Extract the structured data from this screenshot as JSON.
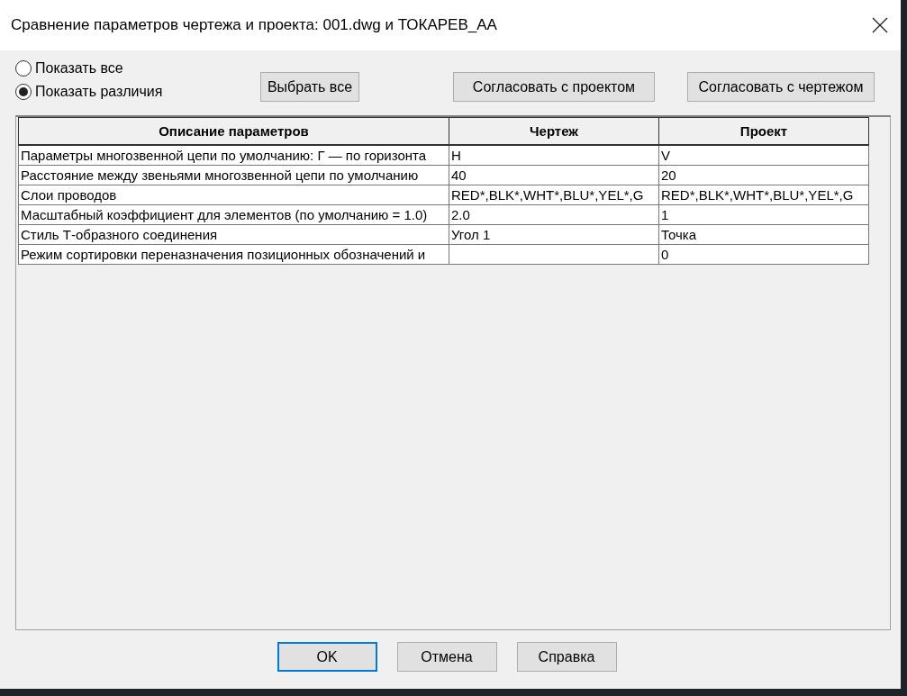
{
  "window": {
    "title": "Сравнение параметров чертежа и проекта: 001.dwg и ТОКАРЕВ_АА"
  },
  "filter_options": [
    {
      "label": "Показать все",
      "selected": false
    },
    {
      "label": "Показать различия",
      "selected": true
    }
  ],
  "action_buttons": [
    "Выбрать все",
    "Согласовать с проектом",
    "Согласовать с чертежом"
  ],
  "table": {
    "columns": [
      "Описание параметров",
      "Чертеж",
      "Проект"
    ],
    "rows": [
      [
        "Параметры многозвенной цепи по умолчанию: Г — по горизонта",
        "H",
        "V"
      ],
      [
        "Расстояние между звеньями многозвенной цепи по умолчанию",
        "40",
        "20"
      ],
      [
        "Слои проводов",
        "RED*,BLK*,WHT*,BLU*,YEL*,G",
        "RED*,BLK*,WHT*,BLU*,YEL*,G"
      ],
      [
        "Масштабный коэффициент для элементов (по умолчанию = 1.0)",
        "2.0",
        "1"
      ],
      [
        "Стиль Т-образного соединения",
        "Угол 1",
        "Точка"
      ],
      [
        "Режим сортировки переназначения позиционных обозначений и",
        "",
        "0"
      ]
    ]
  },
  "footer_buttons": [
    {
      "label": "OK",
      "default": true
    },
    {
      "label": "Отмена",
      "default": false
    },
    {
      "label": "Справка",
      "default": false
    }
  ]
}
